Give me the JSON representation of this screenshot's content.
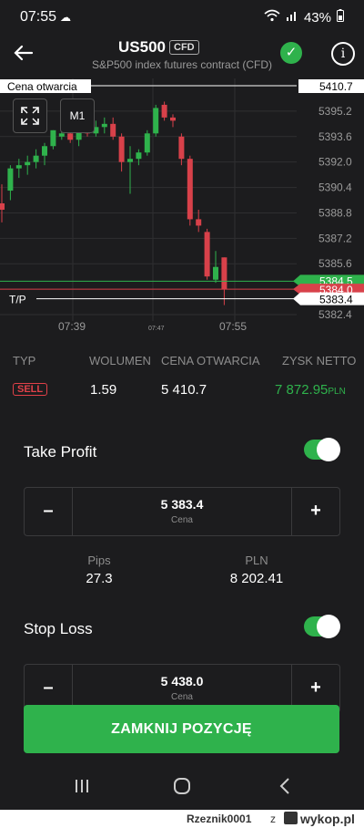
{
  "status": {
    "time": "07:55",
    "battery": "43%"
  },
  "header": {
    "symbol": "US500",
    "badge": "CFD",
    "description": "S&P500 index futures contract (CFD)"
  },
  "chart": {
    "open_label": "Cena otwarcia",
    "open_price": "5410.7",
    "tp_label": "T/P",
    "tp_price": "5383.4",
    "current_price": "5384.5",
    "current_price_red": "5384.0",
    "timeframe": "M1",
    "y_ticks": [
      "5395.2",
      "5393.6",
      "5392.0",
      "5390.4",
      "5388.8",
      "5387.2",
      "5385.6",
      "5382.4"
    ],
    "x_ticks": [
      "07:39",
      "07:47",
      "07:55"
    ]
  },
  "chart_data": {
    "type": "candlestick",
    "ylim": [
      5382.0,
      5396.8
    ],
    "candles": [
      {
        "o": 5389.4,
        "h": 5390.6,
        "l": 5388.2,
        "c": 5389.0
      },
      {
        "o": 5390.2,
        "h": 5391.8,
        "l": 5389.6,
        "c": 5391.6
      },
      {
        "o": 5391.6,
        "h": 5392.2,
        "l": 5391.0,
        "c": 5391.8
      },
      {
        "o": 5391.8,
        "h": 5392.4,
        "l": 5391.2,
        "c": 5392.0
      },
      {
        "o": 5392.0,
        "h": 5392.8,
        "l": 5391.6,
        "c": 5392.4
      },
      {
        "o": 5392.4,
        "h": 5393.2,
        "l": 5391.8,
        "c": 5393.0
      },
      {
        "o": 5393.0,
        "h": 5394.0,
        "l": 5392.8,
        "c": 5394.0
      },
      {
        "o": 5393.6,
        "h": 5394.4,
        "l": 5393.4,
        "c": 5393.8
      },
      {
        "o": 5393.8,
        "h": 5394.4,
        "l": 5393.2,
        "c": 5393.4
      },
      {
        "o": 5393.4,
        "h": 5394.2,
        "l": 5393.0,
        "c": 5394.0
      },
      {
        "o": 5394.0,
        "h": 5394.6,
        "l": 5393.6,
        "c": 5393.8
      },
      {
        "o": 5393.8,
        "h": 5394.6,
        "l": 5393.6,
        "c": 5394.2
      },
      {
        "o": 5394.2,
        "h": 5394.8,
        "l": 5393.8,
        "c": 5394.4
      },
      {
        "o": 5394.4,
        "h": 5394.8,
        "l": 5393.4,
        "c": 5393.6
      },
      {
        "o": 5393.6,
        "h": 5393.8,
        "l": 5391.4,
        "c": 5392.0
      },
      {
        "o": 5392.0,
        "h": 5393.0,
        "l": 5390.0,
        "c": 5392.2
      },
      {
        "o": 5392.2,
        "h": 5392.8,
        "l": 5391.8,
        "c": 5392.6
      },
      {
        "o": 5392.6,
        "h": 5394.0,
        "l": 5392.4,
        "c": 5393.8
      },
      {
        "o": 5393.8,
        "h": 5395.6,
        "l": 5393.6,
        "c": 5395.4
      },
      {
        "o": 5395.6,
        "h": 5395.8,
        "l": 5394.6,
        "c": 5394.8
      },
      {
        "o": 5394.8,
        "h": 5395.0,
        "l": 5394.2,
        "c": 5394.6
      },
      {
        "o": 5393.6,
        "h": 5393.8,
        "l": 5391.8,
        "c": 5392.2
      },
      {
        "o": 5392.2,
        "h": 5392.4,
        "l": 5388.0,
        "c": 5388.4
      },
      {
        "o": 5388.4,
        "h": 5389.0,
        "l": 5387.6,
        "c": 5388.0
      },
      {
        "o": 5387.6,
        "h": 5387.8,
        "l": 5384.6,
        "c": 5384.8
      },
      {
        "o": 5384.6,
        "h": 5386.4,
        "l": 5384.4,
        "c": 5385.4
      },
      {
        "o": 5386.0,
        "h": 5386.0,
        "l": 5383.0,
        "c": 5384.0
      }
    ]
  },
  "table": {
    "headers": [
      "TYP",
      "WOLUMEN",
      "CENA OTWARCIA",
      "ZYSK NETTO"
    ],
    "type": "SELL",
    "volume": "1.59",
    "open_price": "5 410.7",
    "profit": "7 872.95",
    "profit_currency": "PLN"
  },
  "take_profit": {
    "label": "Take Profit",
    "value": "5 383.4",
    "sub": "Cena",
    "pips_label": "Pips",
    "pips": "27.3",
    "pln_label": "PLN",
    "pln": "8 202.41"
  },
  "stop_loss": {
    "label": "Stop Loss",
    "value": "5 438.0",
    "sub": "Cena"
  },
  "close_button": "ZAMKNIJ POZYCJĘ",
  "footer": {
    "user": "Rzeznik0001",
    "z": "z",
    "site": "wykop.pl"
  },
  "colors": {
    "up": "#2fb24c",
    "down": "#d8414a",
    "bg": "#1c1c1e"
  }
}
